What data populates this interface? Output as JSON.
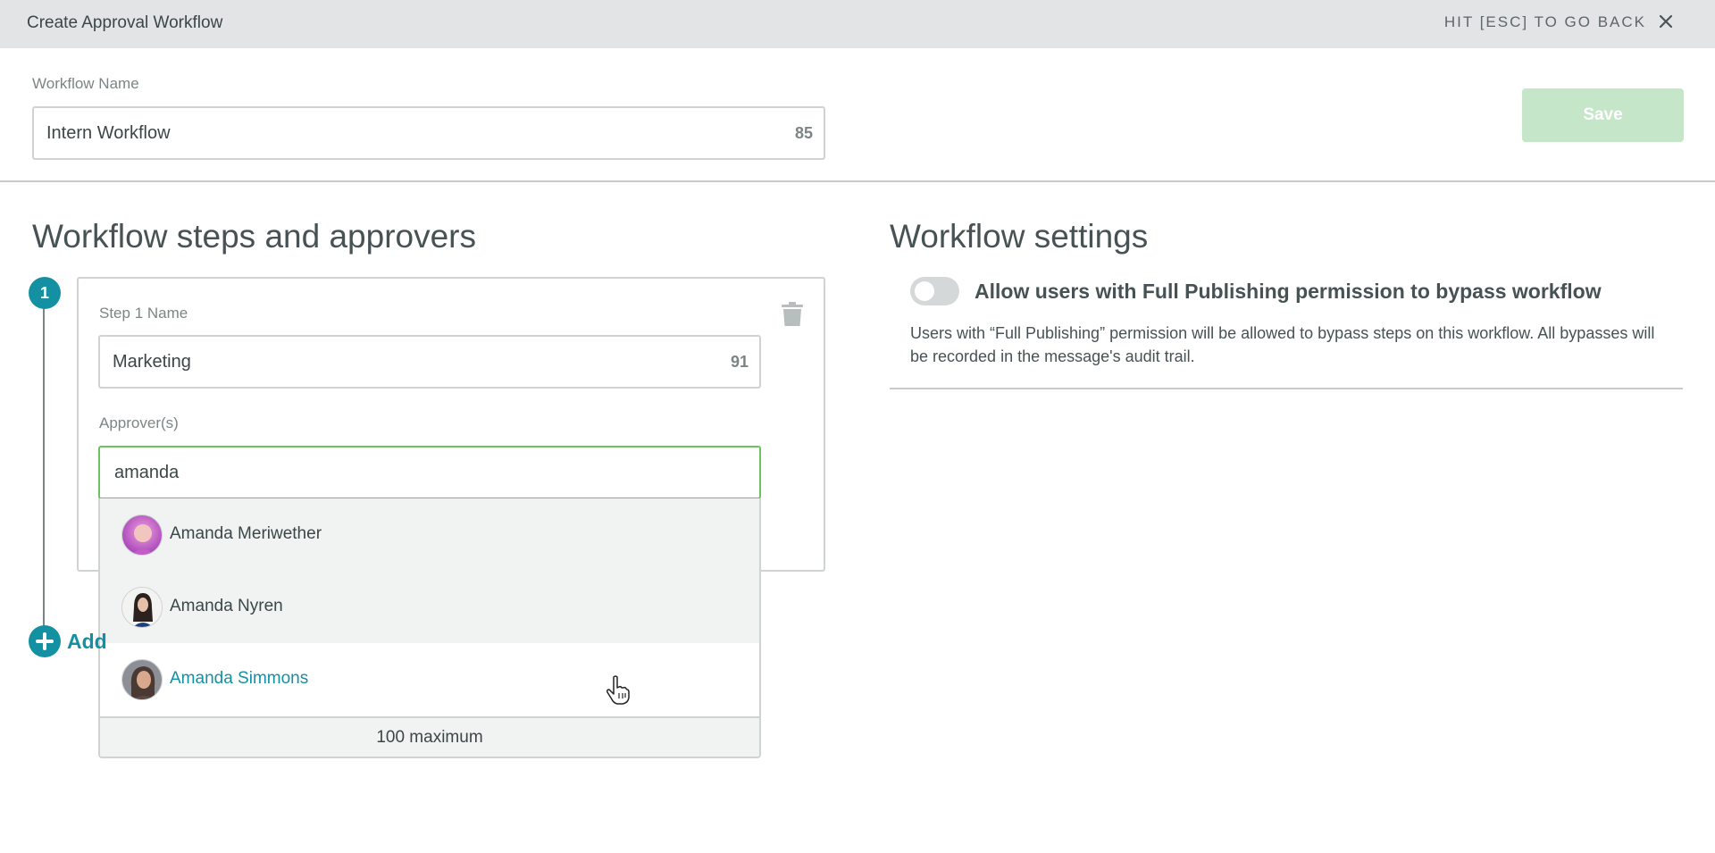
{
  "header": {
    "title": "Create Approval Workflow",
    "esc_hint": "HIT [ESC] TO GO BACK",
    "close_icon": "close-icon"
  },
  "workflow_name": {
    "label": "Workflow Name",
    "value": "Intern Workflow",
    "remaining": "85"
  },
  "save_label": "Save",
  "steps_section": {
    "title": "Workflow steps and approvers",
    "step": {
      "number": "1",
      "name_label": "Step 1 Name",
      "name_value": "Marketing",
      "name_remaining": "91",
      "approvers_label": "Approver(s)",
      "approver_query": "amanda",
      "trash_icon": "trash-icon"
    },
    "suggestions": [
      {
        "name": "Amanda Meriwether"
      },
      {
        "name": "Amanda Nyren"
      },
      {
        "name": "Amanda Simmons"
      }
    ],
    "suggestions_footer": "100 maximum",
    "add_step_label": "Add"
  },
  "settings_section": {
    "title": "Workflow settings",
    "bypass_toggle_on": false,
    "bypass_title": "Allow users with Full Publishing permission to bypass workflow",
    "bypass_description": "Users with “Full Publishing” permission will be allowed to bypass steps on this workflow. All bypasses will be recorded in the message's audit trail."
  },
  "colors": {
    "accent": "#1490a3",
    "focus_border": "#6ac35f",
    "save_disabled": "#c5e6c9"
  }
}
